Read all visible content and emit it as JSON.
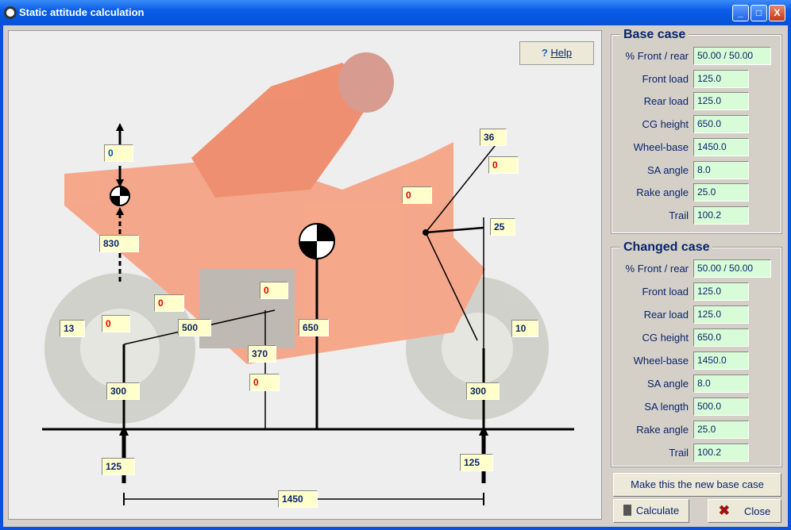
{
  "window": {
    "title": "Static attitude calculation",
    "minimize": "_",
    "maximize": "□",
    "close": "X"
  },
  "diagram": {
    "help_label": "Help",
    "values": {
      "rear_top_force": "0",
      "rear_cg_height": "830",
      "rear_tilt": "13",
      "rear_axle_a": "0",
      "rear_axle_b": "0",
      "sa_length": "500",
      "sa_pivot_a": "0",
      "sa_pivot_height": "370",
      "sa_pivot_b": "0",
      "cg_height": "650",
      "rear_axle_height": "300",
      "front_axle_height": "300",
      "steer_head_angle": "36",
      "steer_head_a": "0",
      "steer_head_b": "0",
      "offset": "25",
      "front_tilt": "10",
      "rear_load": "125",
      "front_load": "125",
      "wheelbase": "1450"
    }
  },
  "base_case": {
    "title": "Base case",
    "rows": [
      {
        "label": "% Front / rear",
        "value": "50.00 / 50.00"
      },
      {
        "label": "Front load",
        "value": "125.0"
      },
      {
        "label": "Rear load",
        "value": "125.0"
      },
      {
        "label": "CG height",
        "value": "650.0"
      },
      {
        "label": "Wheel-base",
        "value": "1450.0"
      },
      {
        "label": "SA angle",
        "value": " 8.0"
      },
      {
        "label": "Rake angle",
        "value": "25.0"
      },
      {
        "label": "Trail",
        "value": "100.2"
      }
    ]
  },
  "changed_case": {
    "title": "Changed case",
    "rows": [
      {
        "label": "% Front / rear",
        "value": "50.00 / 50.00"
      },
      {
        "label": "Front load",
        "value": "125.0"
      },
      {
        "label": "Rear load",
        "value": "125.0"
      },
      {
        "label": "CG height",
        "value": "650.0"
      },
      {
        "label": "Wheel-base",
        "value": "1450.0"
      },
      {
        "label": "SA angle",
        "value": " 8.0"
      },
      {
        "label": "SA length",
        "value": "500.0"
      },
      {
        "label": "Rake  angle",
        "value": "25.0"
      },
      {
        "label": "Trail",
        "value": "100.2"
      }
    ]
  },
  "buttons": {
    "make_base": "Make this the new base case",
    "calculate": "Calculate",
    "close": "Close"
  },
  "colors": {
    "field_bg": "#d8fcd8",
    "value_box_bg": "#ffffcc",
    "bike": "#f8a080",
    "changed_value": "#e00000"
  }
}
